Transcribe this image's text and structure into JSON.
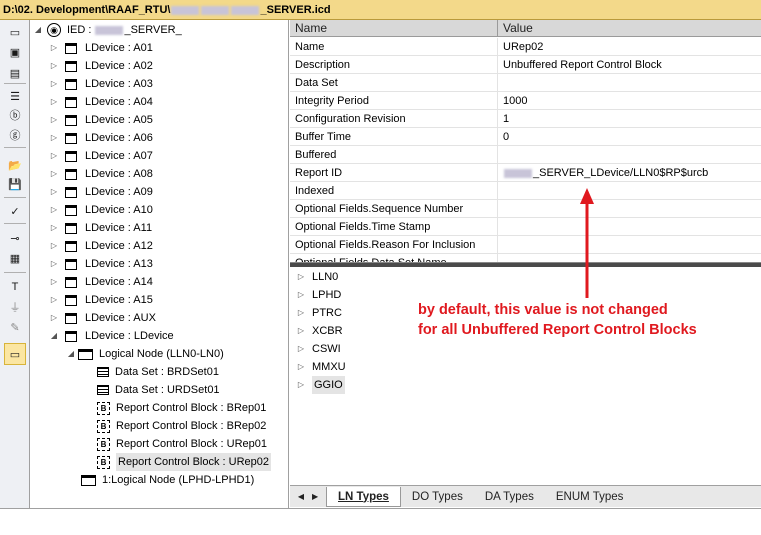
{
  "title": {
    "part1": "D:\\02. Development\\RAAF_RTU\\",
    "part2": "_SERVER.icd"
  },
  "toolbar": {
    "icons": [
      "window-icon",
      "open-project-icon",
      "project-icon",
      "list-icon",
      "report-icon",
      "goose-icon",
      "folder-open-icon",
      "save-icon",
      "check-icon",
      "link-icon",
      "table-icon",
      "text-icon",
      "ground-icon",
      "edit-icon",
      "layout-icon"
    ]
  },
  "tree": {
    "ied": {
      "prefix": "IED :",
      "suffix": "_SERVER_"
    },
    "ldevices": [
      "LDevice : A01",
      "LDevice : A02",
      "LDevice : A03",
      "LDevice : A04",
      "LDevice : A05",
      "LDevice : A06",
      "LDevice : A07",
      "LDevice : A08",
      "LDevice : A09",
      "LDevice : A10",
      "LDevice : A11",
      "LDevice : A12",
      "LDevice : A13",
      "LDevice : A14",
      "LDevice : A15",
      "LDevice : AUX",
      "LDevice : LDevice"
    ],
    "logical_node": "Logical Node (LLN0-LN0)",
    "children": [
      {
        "icon": "ds",
        "label": "Data Set : BRDSet01"
      },
      {
        "icon": "ds",
        "label": "Data Set : URDSet01"
      },
      {
        "icon": "rb",
        "label": "Report Control Block : BRep01"
      },
      {
        "icon": "rb",
        "label": "Report Control Block : BRep02"
      },
      {
        "icon": "rb",
        "label": "Report Control Block : URep01"
      },
      {
        "icon": "rb",
        "label": "Report Control Block : URep02"
      }
    ],
    "logical_node2": "1:Logical Node (LPHD-LPHD1)"
  },
  "props": {
    "header": {
      "name": "Name",
      "value": "Value"
    },
    "rows": [
      {
        "name": "Name",
        "value": "URep02"
      },
      {
        "name": "Description",
        "value": "Unbuffered Report Control Block"
      },
      {
        "name": "Data Set",
        "value": ""
      },
      {
        "name": "Integrity Period",
        "value": "1000"
      },
      {
        "name": "Configuration Revision",
        "value": "1"
      },
      {
        "name": "Buffer Time",
        "value": "0"
      },
      {
        "name": "Buffered",
        "value": ""
      },
      {
        "name": "Report ID",
        "value": "_SERVER_LDevice/LLN0$RP$urcb"
      },
      {
        "name": "Indexed",
        "value": ""
      },
      {
        "name": "Optional Fields.Sequence Number",
        "value": ""
      },
      {
        "name": "Optional Fields.Time Stamp",
        "value": ""
      },
      {
        "name": "Optional Fields.Reason For Inclusion",
        "value": ""
      },
      {
        "name": "Optional Fields.Data Set Name",
        "value": ""
      }
    ]
  },
  "types": [
    "LLN0",
    "LPHD",
    "PTRC",
    "XCBR",
    "CSWI",
    "MMXU",
    "GGIO"
  ],
  "annotation": {
    "line1": "by default, this value is not changed",
    "line2": "for all Unbuffered Report Control Blocks",
    "color": "#e0191f"
  },
  "tabs": [
    "LN Types",
    "DO Types",
    "DA Types",
    "ENUM Types"
  ]
}
